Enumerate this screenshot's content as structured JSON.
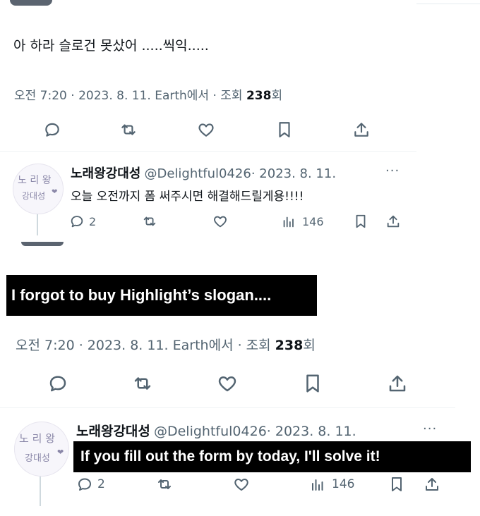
{
  "top_tweet": {
    "text": "아 하라 슬로건 못샀어 .....씩익.....",
    "meta_prefix": "오전 7:20 · 2023. 8. 11. Earth에서 · 조회 ",
    "views": "238",
    "meta_suffix": "회"
  },
  "reply": {
    "avatar_text_line1": "노 리 왕",
    "avatar_text_line2": "강대성",
    "name": "노래왕강대성",
    "handle": "@Delightful0426",
    "date": "· 2023. 8. 11.",
    "more": "···",
    "text": "오늘 오전까지 폼 써주시면 해결해드릴게용!!!!",
    "reply_count": "2",
    "views_count": "146"
  },
  "second_tweet": {
    "meta_prefix": "오전 7:20 · 2023. 8. 11. Earth에서 · 조회 ",
    "views": "238",
    "meta_suffix": "회"
  },
  "second_reply": {
    "avatar_text_line1": "노 리 왕",
    "avatar_text_line2": "강대성",
    "name": "노래왕강대성",
    "handle": "@Delightful0426",
    "date": "· 2023. 8. 11.",
    "more": "···",
    "reply_count": "2",
    "views_count": "146"
  },
  "captions": {
    "caption1": "I forgot to buy Highlight’s slogan....",
    "caption2": "If you fill out the form by today, I'll solve it!"
  },
  "icons": [
    "reply-icon",
    "retweet-icon",
    "like-icon",
    "bookmark-icon",
    "share-icon",
    "views-icon",
    "more-icon"
  ],
  "colors": {
    "icon_gray": "#536471",
    "text": "#0f1419",
    "caption_bg": "#000000"
  }
}
